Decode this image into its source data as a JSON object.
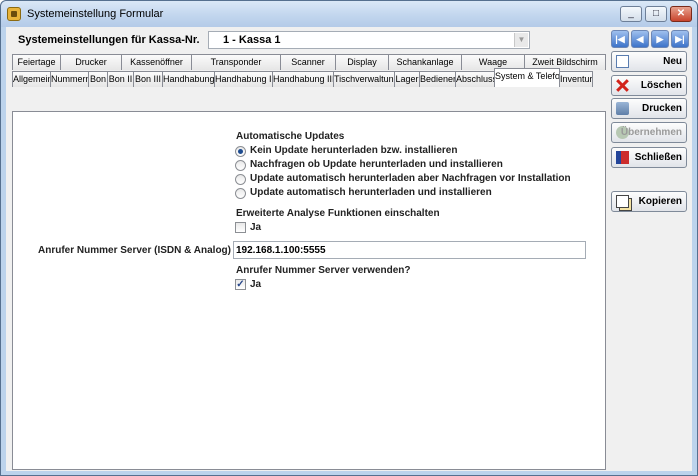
{
  "window": {
    "title": "Systemeinstellung Formular",
    "controls": [
      "_",
      "□",
      "✕"
    ]
  },
  "header": {
    "label": "Systemeinstellungen für Kassa-Nr.",
    "kassa_value": "1 - Kassa 1"
  },
  "nav": {
    "first": "|◀",
    "prev": "◀",
    "next": "▶",
    "last": "▶|"
  },
  "tabs": {
    "row1": [
      "Feiertage",
      "Drucker",
      "Kassenöffner",
      "Transponder",
      "Scanner",
      "Display",
      "Schankanlage",
      "Waage",
      "Zweit Bildschirm"
    ],
    "row2": [
      "Allgemein",
      "Nummern",
      "Bon",
      "Bon II",
      "Bon III",
      "Handhabung",
      "Handhabung II",
      "Handhabung III",
      "Tischverwaltung",
      "Lager",
      "Bediener",
      "Abschluss",
      "System & Telefon",
      "Inventur"
    ],
    "active": "System & Telefon"
  },
  "updates": {
    "title": "Automatische Updates",
    "options": [
      {
        "label": "Kein Update herunterladen bzw. installieren",
        "checked": true
      },
      {
        "label": "Nachfragen ob Update herunterladen und installieren",
        "checked": false
      },
      {
        "label": "Update automatisch herunterladen aber Nachfragen vor Installation",
        "checked": false
      },
      {
        "label": "Update automatisch herunterladen und installieren",
        "checked": false
      }
    ]
  },
  "analysis": {
    "title": "Erweiterte Analyse Funktionen einschalten",
    "label": "Ja",
    "checked": false
  },
  "caller_server": {
    "label": "Anrufer Nummer Server (ISDN & Analog)",
    "value": "192.168.1.100:5555"
  },
  "caller_use": {
    "title": "Anrufer Nummer Server verwenden?",
    "label": "Ja",
    "checked": true,
    "check_glyph": "✓"
  },
  "buttons": {
    "new": "Neu",
    "delete": "Löschen",
    "print": "Drucken",
    "apply": "Übernehmen",
    "close": "Schließen",
    "copy": "Kopieren"
  },
  "colors": {
    "titlebar": "#c2d6ee",
    "nav_button": "#3d73c9",
    "delete_icon": "#d2231b"
  }
}
